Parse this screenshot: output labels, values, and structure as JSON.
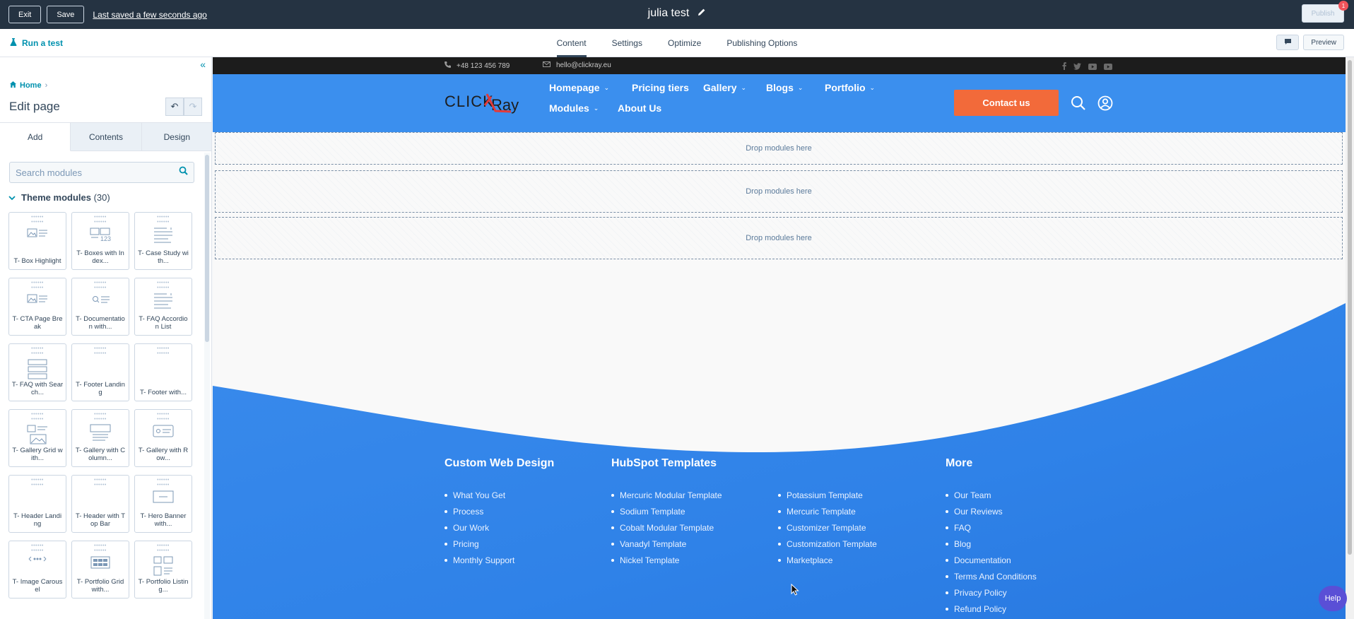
{
  "topbar": {
    "exit_label": "Exit",
    "save_label": "Save",
    "last_saved": "Last saved a few seconds ago",
    "page_title": "julia test",
    "publish_label": "Publish",
    "notification_count": "1"
  },
  "subbar": {
    "run_test_label": "Run a test",
    "tabs": [
      "Content",
      "Settings",
      "Optimize",
      "Publishing Options"
    ],
    "active_tab": "Content",
    "preview_label": "Preview"
  },
  "sidebar": {
    "breadcrumb_home": "Home",
    "heading": "Edit page",
    "tabs": [
      "Add",
      "Contents",
      "Design"
    ],
    "active_tab": "Add",
    "search_placeholder": "Search modules",
    "section_title": "Theme modules",
    "section_count": "(30)",
    "modules": [
      {
        "label": "T- Box Highlight",
        "icon": "image-text-icon"
      },
      {
        "label": "T- Boxes with In dex...",
        "icon": "number-boxes-icon"
      },
      {
        "label": "T- Case Study wi th...",
        "icon": "text-lines-icon"
      },
      {
        "label": "T- CTA Page Bre ak",
        "icon": "image-text-icon"
      },
      {
        "label": "T- Documentatio n with...",
        "icon": "search-list-icon"
      },
      {
        "label": "T- FAQ Accordio n List",
        "icon": "text-lines-icon"
      },
      {
        "label": "T- FAQ with Sear ch...",
        "icon": "stacked-rows-icon"
      },
      {
        "label": "T- Footer Landin g",
        "icon": "blank-icon"
      },
      {
        "label": "T- Footer with...",
        "icon": "blank-icon"
      },
      {
        "label": "T- Gallery Grid w ith...",
        "icon": "gallery-grid-icon"
      },
      {
        "label": "T- Gallery with C olumn...",
        "icon": "text-block-icon"
      },
      {
        "label": "T- Gallery with R ow...",
        "icon": "gallery-row-icon"
      },
      {
        "label": "T- Header Landi ng",
        "icon": "blank-icon"
      },
      {
        "label": "T- Header with T op Bar",
        "icon": "blank-icon"
      },
      {
        "label": "T- Hero Banner with...",
        "icon": "banner-icon"
      },
      {
        "label": "T- Image Carous el",
        "icon": "carousel-icon"
      },
      {
        "label": "T- Portfolio Grid with...",
        "icon": "portfolio-grid-icon"
      },
      {
        "label": "T- Portfolio Listin g...",
        "icon": "portfolio-list-icon"
      }
    ]
  },
  "site": {
    "phone": "+48 123 456 789",
    "email": "hello@clickray.eu",
    "logo_text_a": "CLICK",
    "logo_text_b": "Ray",
    "nav": [
      {
        "label": "Homepage",
        "dropdown": true
      },
      {
        "label": "Pricing tiers",
        "dropdown": false
      },
      {
        "label": "Gallery",
        "dropdown": true
      },
      {
        "label": "Blogs",
        "dropdown": true
      },
      {
        "label": "Portfolio",
        "dropdown": true
      },
      {
        "label": "Modules",
        "dropdown": true
      },
      {
        "label": "About Us",
        "dropdown": false
      }
    ],
    "contact_label": "Contact us",
    "dropzone_label": "Drop modules here",
    "footer": {
      "col1": {
        "title": "Custom Web Design",
        "items": [
          "What You Get",
          "Process",
          "Our Work",
          "Pricing",
          "Monthly Support"
        ]
      },
      "col2": {
        "title": "HubSpot Templates",
        "items": [
          "Mercuric Modular Template",
          "Sodium Template",
          "Cobalt Modular Template",
          "Vanadyl Template",
          "Nickel Template"
        ]
      },
      "col3": {
        "title": "",
        "items": [
          "Potassium Template",
          "Mercuric Template",
          "Customizer Template",
          "Customization Template",
          "Marketplace"
        ]
      },
      "col4": {
        "title": "More",
        "items": [
          "Our Team",
          "Our Reviews",
          "FAQ",
          "Blog",
          "Documentation",
          "Terms And Conditions",
          "Privacy Policy",
          "Refund Policy"
        ]
      }
    }
  },
  "help_label": "Help",
  "colors": {
    "topbar": "#253342",
    "accent_link": "#0091ae",
    "site_blue": "#3b8fee",
    "contact_orange": "#f26a3a",
    "logo_red": "#e23a3a"
  }
}
